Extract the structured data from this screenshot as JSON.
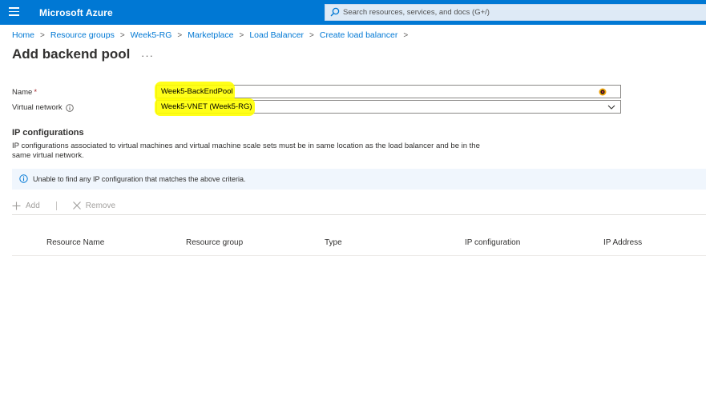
{
  "header": {
    "brand": "Microsoft Azure",
    "search_placeholder": "Search resources, services, and docs (G+/)",
    "accent_color": "#0078d4",
    "icons": [
      "hamburger-icon",
      "search-icon"
    ]
  },
  "breadcrumb": [
    "Home",
    "Resource groups",
    "Week5-RG",
    "Marketplace",
    "Load Balancer",
    "Create load balancer"
  ],
  "page": {
    "title": "Add backend pool",
    "more_label": "···"
  },
  "form": {
    "name_label": "Name",
    "name_required_marker": "*",
    "name_value": "Week5-BackEndPool",
    "vnet_label": "Virtual network",
    "vnet_value": "Week5-VNET (Week5-RG)",
    "highlight_color": "#ffff00"
  },
  "ip_configurations": {
    "title": "IP configurations",
    "description": "IP configurations associated to virtual machines and virtual machine scale sets must be in same location as the load balancer and be in the same virtual network.",
    "info_message": "Unable to find any IP configuration that matches the above criteria.",
    "add_label": "Add",
    "remove_label": "Remove",
    "columns": [
      "Resource Name",
      "Resource group",
      "Type",
      "IP configuration",
      "IP Address"
    ],
    "rows": []
  }
}
